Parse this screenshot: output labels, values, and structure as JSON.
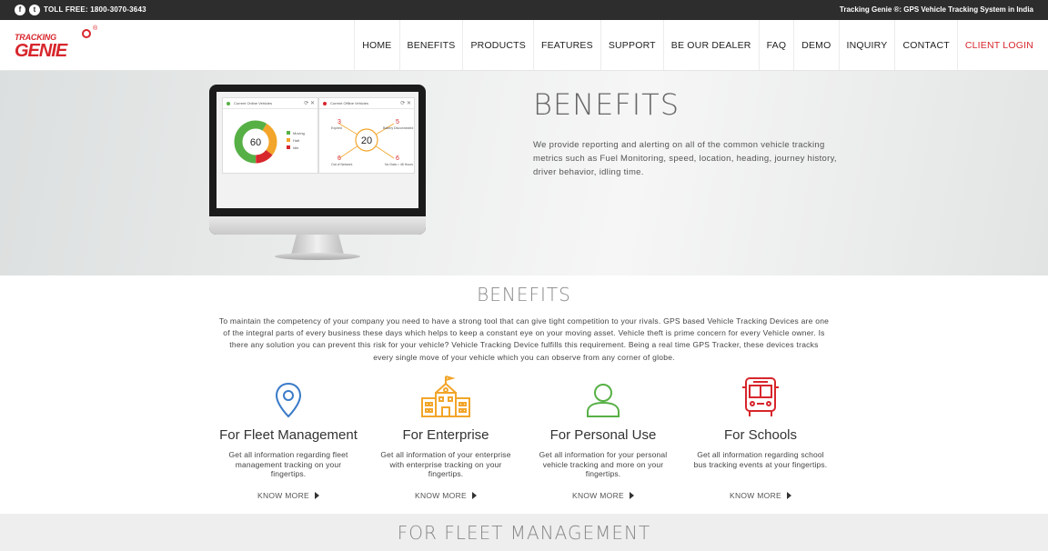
{
  "topbar": {
    "social": [
      {
        "name": "facebook-icon",
        "glyph": "f"
      },
      {
        "name": "twitter-icon",
        "glyph": "t"
      }
    ],
    "tollfree": "TOLL FREE: 1800-3070-3643",
    "tagline": "Tracking Genie ®: GPS Vehicle Tracking System in India"
  },
  "brand": {
    "line1": "TRACKING",
    "line2": "GENIE",
    "reg": "®",
    "color": "#d7262c"
  },
  "nav": {
    "items": [
      "HOME",
      "BENEFITS",
      "PRODUCTS",
      "FEATURES",
      "SUPPORT",
      "BE OUR DEALER",
      "FAQ",
      "DEMO",
      "INQUIRY",
      "CONTACT"
    ],
    "client_login": "CLIENT LOGIN"
  },
  "hero": {
    "title": "BENEFITS",
    "text": "We provide reporting and alerting on all of the common vehicle tracking metrics such as Fuel Monitoring, speed, location, heading, journey history, driver behavior, idling time.",
    "panel1": {
      "title": "Current Online Vehicles",
      "center": "60",
      "legend": [
        "Moving",
        "Halt",
        "Idle"
      ]
    },
    "panel2": {
      "title": "Current Offline Vehicles",
      "center": "20",
      "items": [
        {
          "value": "3",
          "label": "Expired"
        },
        {
          "value": "5",
          "label": "Battery Disconnected"
        },
        {
          "value": "6",
          "label": "Out of Network"
        },
        {
          "value": "6",
          "label": "No Data > 48 Hours"
        }
      ]
    }
  },
  "benefits": {
    "title": "BENEFITS",
    "intro": "To maintain the competency of your company you need to have a strong tool that can give tight competition to your rivals. GPS based Vehicle Tracking Devices are one of the integral parts of every business these days which helps to keep a constant eye on your moving asset. Vehicle theft is prime concern for every Vehicle owner. Is there any solution you can prevent this risk for your vehicle? Vehicle Tracking Device fulfills this requirement. Being a real time GPS Tracker, these devices tracks every single move of your vehicle which you can observe from any corner of globe.",
    "features": [
      {
        "icon": "location-pin-icon",
        "color": "#3a7bc8",
        "title": "For Fleet Management",
        "desc": "Get all information regarding fleet management tracking on your fingertips.",
        "more": "KNOW MORE"
      },
      {
        "icon": "building-icon",
        "color": "#f2a52a",
        "title": "For Enterprise",
        "desc": "Get all information of your enterprise with enterprise tracking on your fingertips.",
        "more": "KNOW MORE"
      },
      {
        "icon": "user-icon",
        "color": "#57b045",
        "title": "For Personal Use",
        "desc": "Get all information for your personal vehicle tracking and more on your fingertips.",
        "more": "KNOW MORE"
      },
      {
        "icon": "school-bus-icon",
        "color": "#d7262c",
        "title": "For Schools",
        "desc": "Get all information regarding school bus tracking events at your fingertips.",
        "more": "KNOW MORE"
      }
    ]
  },
  "fleet": {
    "title": "FOR FLEET MANAGEMENT"
  }
}
